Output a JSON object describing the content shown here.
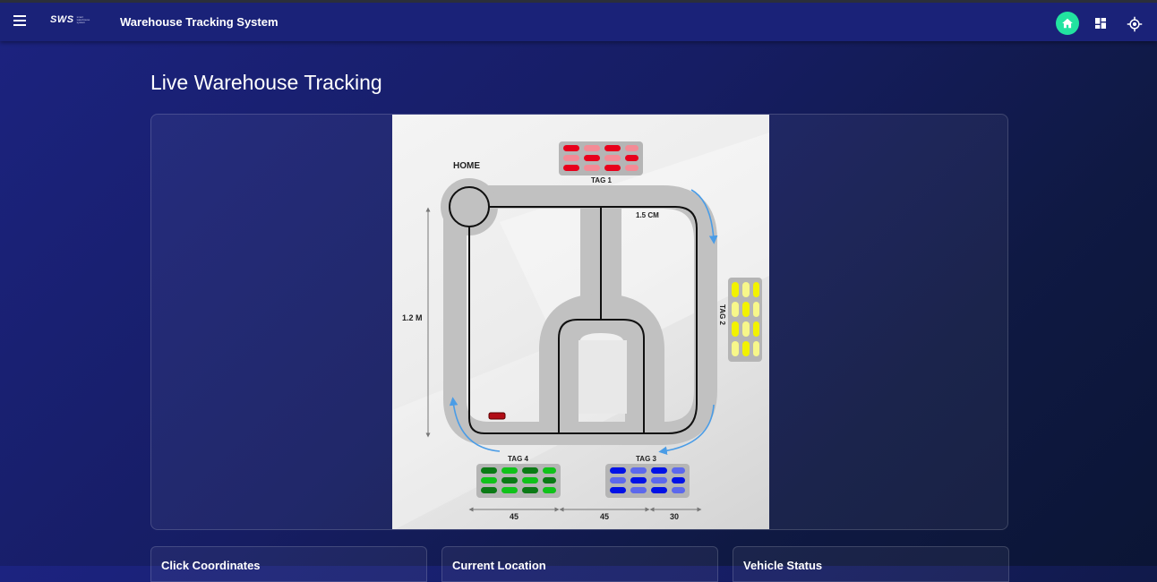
{
  "app": {
    "logo_text": "SWS",
    "logo_sub": "smart warehouse system",
    "title": "Warehouse Tracking System"
  },
  "nav": {
    "icons": [
      "menu-icon",
      "home-icon",
      "dashboard-icon",
      "location-icon"
    ],
    "home_color": "#22e3a0"
  },
  "page": {
    "title": "Live Warehouse Tracking"
  },
  "map": {
    "home_label": "HOME",
    "tags": [
      "TAG 1",
      "TAG 2",
      "TAG 3",
      "TAG 4"
    ],
    "dimensions": {
      "track_width": "1.5 CM",
      "height": "1.2 M",
      "segments": [
        "45",
        "45",
        "30"
      ]
    },
    "tag_colors": {
      "tag1": "#e8001b",
      "tag2": "#f2f200",
      "tag3": "#0011e6",
      "tag4": "#10b010"
    }
  },
  "panels": {
    "click_coordinates": "Click Coordinates",
    "current_location": "Current Location",
    "vehicle_status": "Vehicle Status"
  }
}
